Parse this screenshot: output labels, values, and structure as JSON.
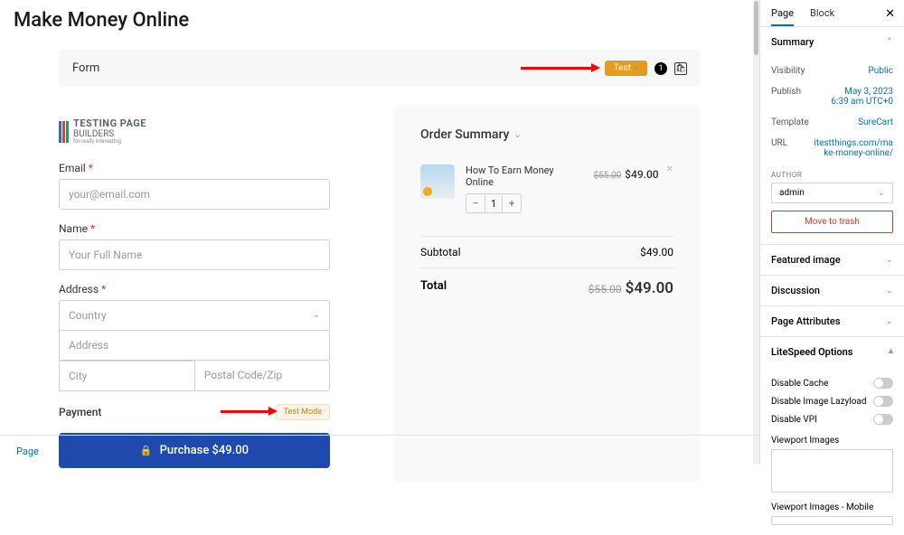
{
  "page_title": "Make Money Online",
  "form_bar": {
    "label": "Form",
    "test_badge": "Test",
    "badge_num": "1"
  },
  "logo": {
    "title": "TESTING PAGE",
    "subtitle": "BUILDERS",
    "tagline": "for really interesting"
  },
  "fields": {
    "email_label": "Email",
    "email_placeholder": "your@email.com",
    "name_label": "Name",
    "name_placeholder": "Your Full Name",
    "address_label": "Address",
    "country_placeholder": "Country",
    "address_placeholder": "Address",
    "city_placeholder": "City",
    "postal_placeholder": "Postal Code/Zip"
  },
  "payment": {
    "label": "Payment",
    "test_mode": "Test Mode"
  },
  "purchase_button": "Purchase $49.00",
  "summary": {
    "title": "Order Summary",
    "item_name": "How To Earn Money Online",
    "qty": "1",
    "item_old": "$55.00",
    "item_new": "$49.00",
    "subtotal_label": "Subtotal",
    "subtotal_value": "$49.00",
    "total_label": "Total",
    "total_old": "$55.00",
    "total_new": "$49.00"
  },
  "sidebar": {
    "tabs": {
      "page": "Page",
      "block": "Block"
    },
    "summary_title": "Summary",
    "visibility": {
      "label": "Visibility",
      "value": "Public"
    },
    "publish": {
      "label": "Publish",
      "value": "May 3, 2023\n6:39 am UTC+0"
    },
    "template": {
      "label": "Template",
      "value": "SureCart"
    },
    "url": {
      "label": "URL",
      "value": "itestthings.com/make-money-online/"
    },
    "author_label": "AUTHOR",
    "author_value": "admin",
    "trash": "Move to trash",
    "featured": "Featured image",
    "discussion": "Discussion",
    "attributes": "Page Attributes",
    "litespeed": "LiteSpeed Options",
    "ls_cache": "Disable Cache",
    "ls_lazy": "Disable Image Lazyload",
    "ls_vpi": "Disable VPI",
    "ls_vimg": "Viewport Images",
    "ls_vimg_m": "Viewport Images - Mobile"
  },
  "footer": "Page"
}
